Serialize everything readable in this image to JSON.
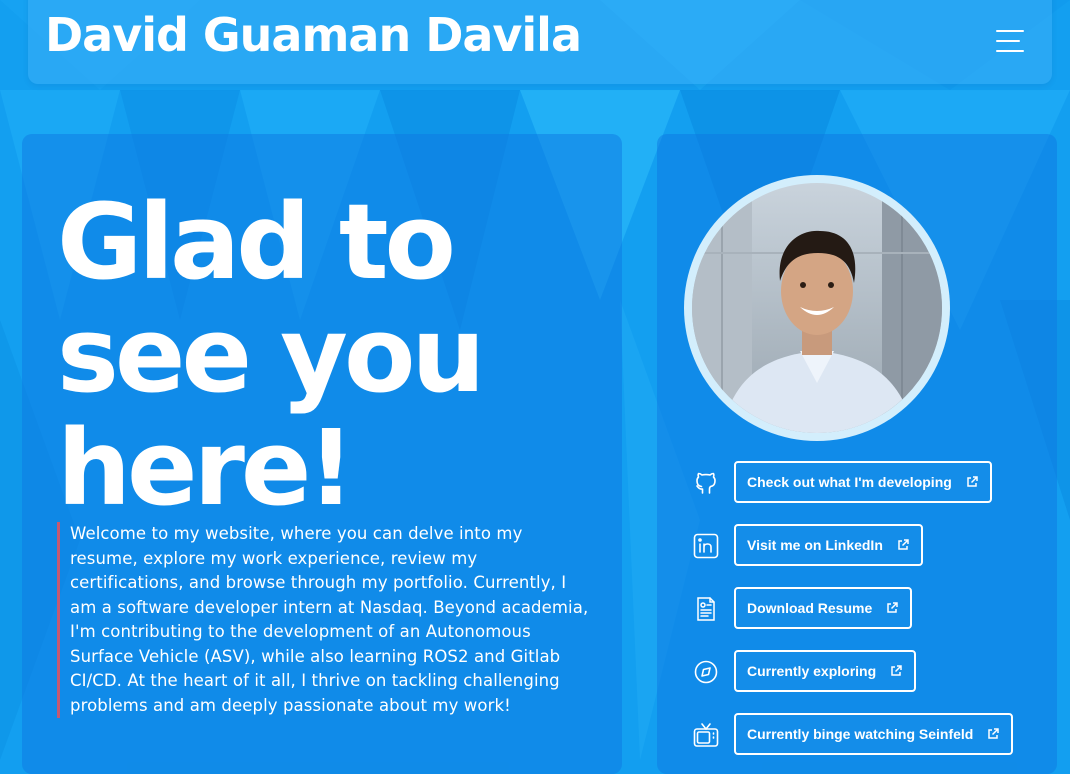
{
  "header": {
    "title": "David Guaman Davila",
    "menu_icon": "hamburger-menu-icon"
  },
  "hero": {
    "title": "Glad to see you here!",
    "intro": "Welcome to my website, where you can delve into my resume, explore my work experience, review my certifications, and browse through my portfolio. Currently, I am a software developer intern at Nasdaq. Beyond academia, I'm contributing to the development of an Autonomous Surface Vehicle (ASV), while also learning ROS2 and Gitlab CI/CD. At the heart of it all, I thrive on tackling challenging problems and am deeply passionate about my work!"
  },
  "profile": {
    "avatar_icon": "profile-photo"
  },
  "links": [
    {
      "label": "Check out what I'm developing",
      "icon": "github-icon"
    },
    {
      "label": "Visit me on LinkedIn",
      "icon": "linkedin-icon"
    },
    {
      "label": "Download Resume",
      "icon": "resume-icon"
    },
    {
      "label": "Currently exploring",
      "icon": "explore-icon"
    },
    {
      "label": "Currently binge watching Seinfeld",
      "icon": "tv-icon"
    }
  ],
  "colors": {
    "background": "#129ef0",
    "card": "#0e78e1",
    "accent_border": "#c45a73",
    "text": "#ffffff"
  }
}
